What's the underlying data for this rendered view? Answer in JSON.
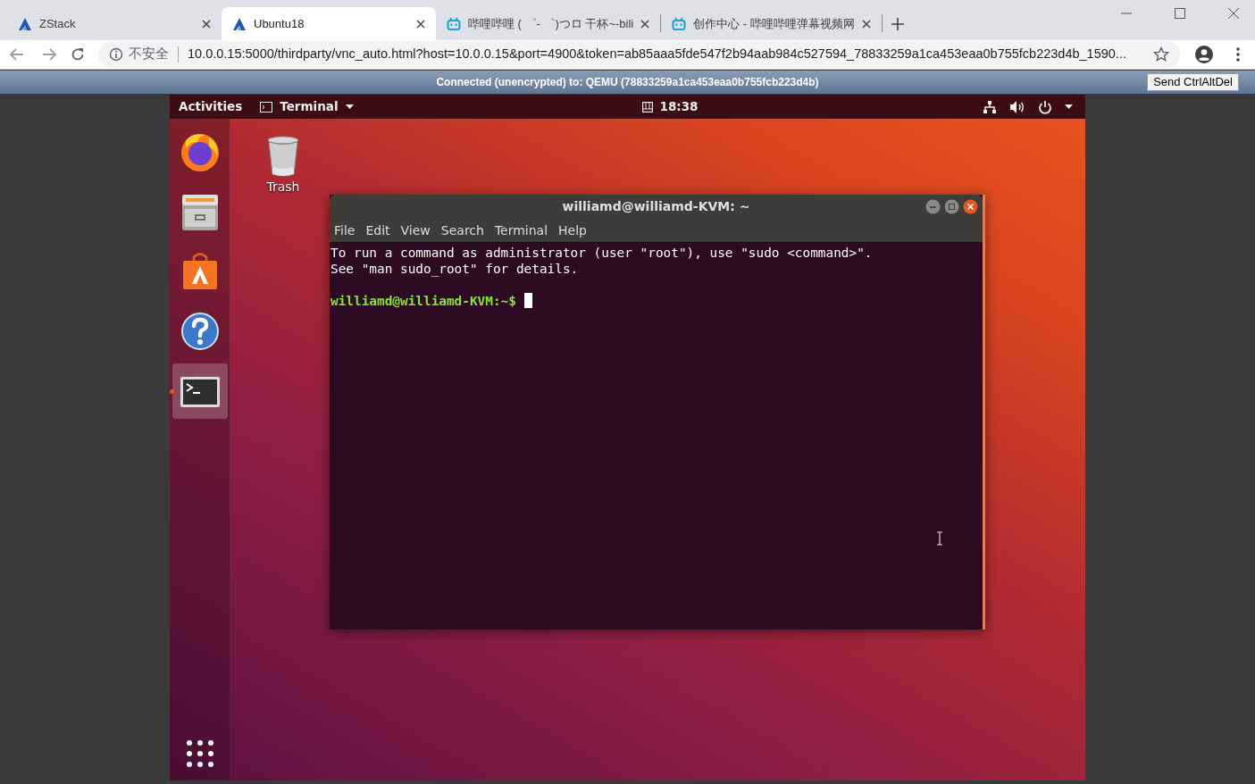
{
  "browser": {
    "tabs": [
      {
        "title": "ZStack",
        "kind": "zstack",
        "selected": false
      },
      {
        "title": "Ubuntu18",
        "kind": "zstack",
        "selected": true
      },
      {
        "title": "哔哩哔哩 ( ゜- ゜)つロ 干杯~-bili",
        "kind": "bilibili",
        "selected": false
      },
      {
        "title": "创作中心 - 哔哩哔哩弹幕视频网",
        "kind": "bilibili",
        "selected": false
      }
    ],
    "address": {
      "security": "不安全",
      "url": "10.0.0.15:5000/thirdparty/vnc_auto.html?host=10.0.0.15&port=4900&token=ab85aaa5fde547f2b94aab984c527594_78833259a1ca453eaa0b755fcb223d4b_1590..."
    }
  },
  "vnc": {
    "status": "Connected (unencrypted) to: QEMU (78833259a1ca453eaa0b755fcb223d4b)",
    "button": "Send CtrlAltDel"
  },
  "ubuntu": {
    "topbar": {
      "activities": "Activities",
      "app_menu": "Terminal",
      "clock": "18:38"
    },
    "dock": [
      {
        "kind": "firefox",
        "running": false
      },
      {
        "kind": "files",
        "running": false
      },
      {
        "kind": "software",
        "running": false
      },
      {
        "kind": "help",
        "running": false
      },
      {
        "kind": "terminal",
        "running": true
      }
    ],
    "desktop_icons": [
      {
        "label": "Trash"
      }
    ],
    "terminal": {
      "title": "williamd@williamd-KVM: ~",
      "menu": [
        "File",
        "Edit",
        "View",
        "Search",
        "Terminal",
        "Help"
      ],
      "lines": [
        "To run a command as administrator (user \"root\"), use \"sudo <command>\".",
        "See \"man sudo_root\" for details."
      ],
      "prompt": "williamd@williamd-KVM:~$"
    }
  }
}
